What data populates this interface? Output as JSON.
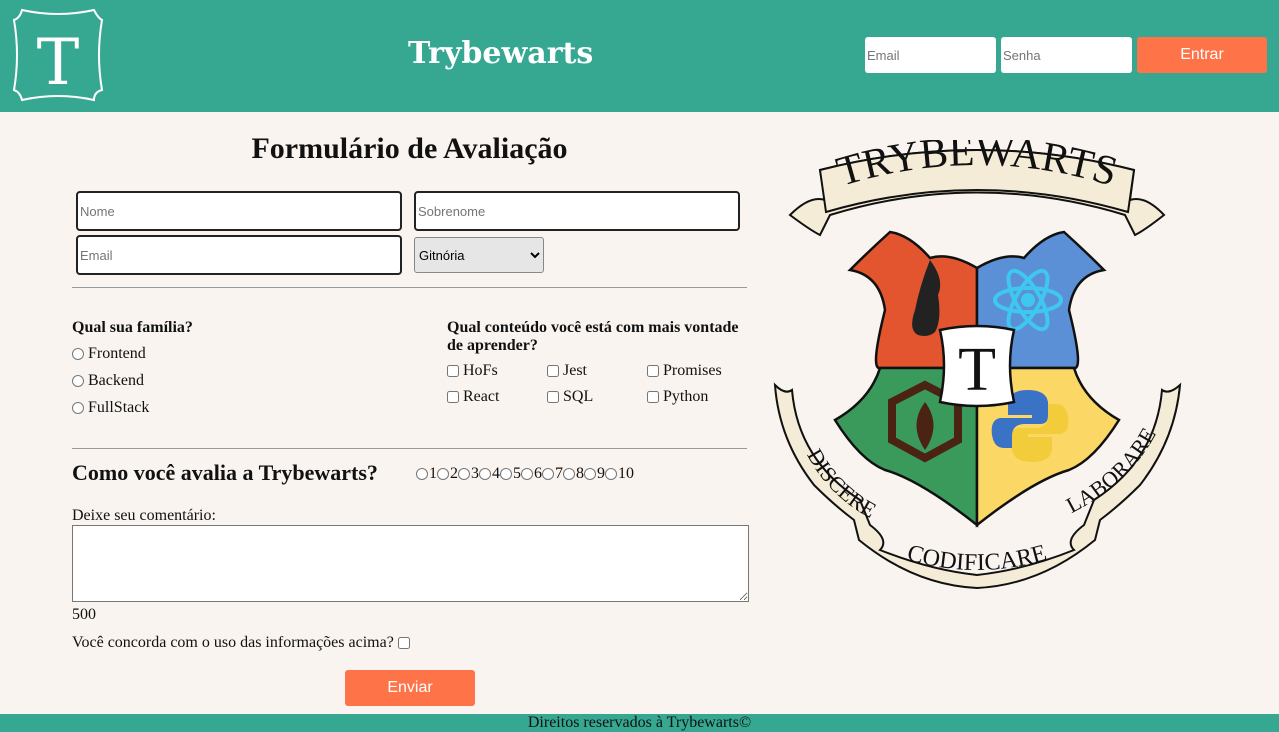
{
  "header": {
    "logo_letter": "T",
    "title": "Trybewarts",
    "email_placeholder": "Email",
    "password_placeholder": "Senha",
    "login_label": "Entrar",
    "bg_color": "#36a892",
    "accent_color": "#fe7448"
  },
  "form": {
    "title": "Formulário de Avaliação",
    "name_placeholder": "Nome",
    "lastname_placeholder": "Sobrenome",
    "email_placeholder": "Email",
    "house_selected": "Gitnória",
    "family_question": "Qual sua família?",
    "families": [
      "Frontend",
      "Backend",
      "FullStack"
    ],
    "subject_question": "Qual conteúdo você está com mais vontade de aprender?",
    "subjects": [
      "HoFs",
      "Jest",
      "Promises",
      "React",
      "SQL",
      "Python"
    ],
    "rate_question": "Como você avalia a Trybewarts?",
    "rates": [
      "1",
      "2",
      "3",
      "4",
      "5",
      "6",
      "7",
      "8",
      "9",
      "10"
    ],
    "comment_label": "Deixe seu comentário:",
    "counter": "500",
    "agreement": "Você concorda com o uso das informações acima?",
    "submit_label": "Enviar"
  },
  "crest": {
    "banner_top": "TRYBEWARTS",
    "center_letter": "T",
    "banner_left": "DISCERE",
    "banner_bottom": "CODIFICARE",
    "banner_right": "LABORARE",
    "quarter_colors": [
      "#e2552f",
      "#5b8fd6",
      "#3a9a5b",
      "#fbd865"
    ]
  },
  "footer": {
    "text": "Direitos reservados à Trybewarts©"
  }
}
